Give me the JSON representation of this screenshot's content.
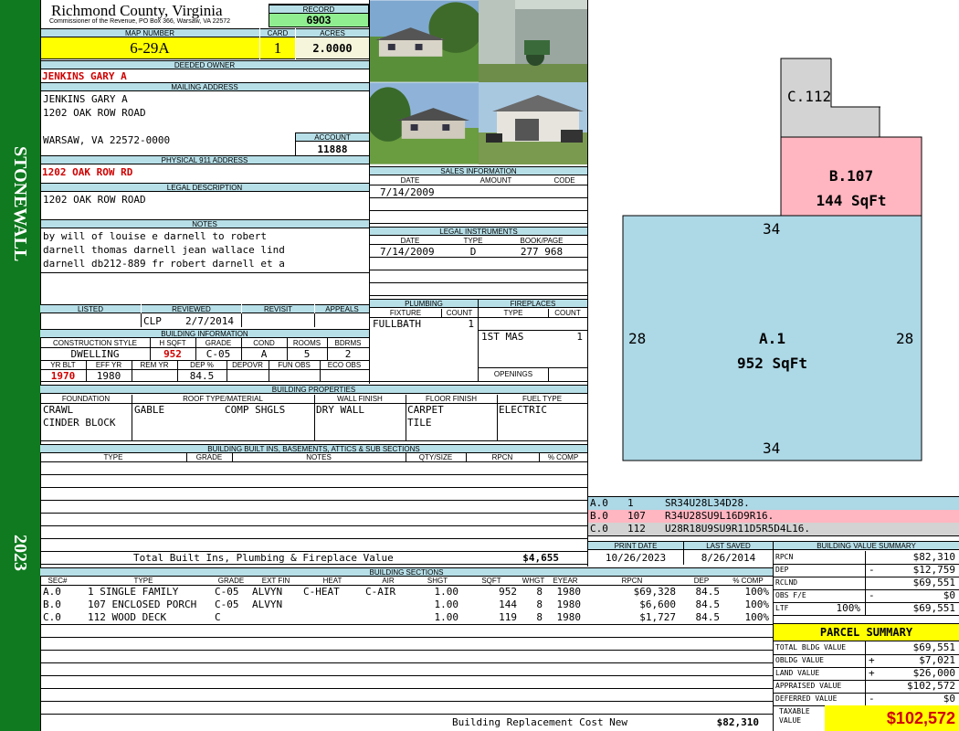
{
  "sidebar": {
    "district": "STONEWALL",
    "year": "2023"
  },
  "header": {
    "county": "Richmond County, Virginia",
    "address_line": "Commissioner of the Revenue, PO Box 366, Warsaw, VA 22572",
    "record_label": "RECORD",
    "record": "6903",
    "map_number_label": "MAP NUMBER",
    "map_number": "6-29A",
    "card_label": "CARD",
    "card": "1",
    "acres_label": "ACRES",
    "acres": "2.0000"
  },
  "owner": {
    "deeded_owner_label": "DEEDED OWNER",
    "deeded_owner": "JENKINS GARY A",
    "mailing_address_label": "MAILING ADDRESS",
    "mailing": [
      "JENKINS GARY A",
      "1202 OAK ROW ROAD",
      "",
      "WARSAW, VA 22572-0000"
    ],
    "account_label": "ACCOUNT",
    "account": "11888",
    "physical_label": "PHYSICAL 911 ADDRESS",
    "physical_address": "1202 OAK ROW RD",
    "legal_label": "LEGAL DESCRIPTION",
    "legal": "1202 OAK ROW ROAD",
    "notes_label": "NOTES",
    "notes": [
      "by will of louise e darnell to robert",
      "darnell thomas darnell jean wallace lind",
      "darnell db212-889 fr robert darnell et a"
    ]
  },
  "sales": {
    "label": "SALES INFORMATION",
    "cols": [
      "DATE",
      "AMOUNT",
      "CODE"
    ],
    "rows": [
      [
        "7/14/2009",
        "",
        ""
      ]
    ]
  },
  "legal_instruments": {
    "label": "LEGAL INSTRUMENTS",
    "cols": [
      "DATE",
      "TYPE",
      "BOOK/PAGE"
    ],
    "rows": [
      [
        "7/14/2009",
        "D",
        "277 968"
      ]
    ]
  },
  "review": {
    "cols": [
      "LISTED",
      "REVIEWED",
      "REVISIT",
      "APPEALS"
    ],
    "reviewed_by": "CLP",
    "reviewed_date": "2/7/2014"
  },
  "building_info": {
    "label": "BUILDING INFORMATION",
    "cols1": [
      "CONSTRUCTION STYLE",
      "H SQFT",
      "GRADE",
      "COND",
      "ROOMS",
      "BDRMS"
    ],
    "vals1": [
      "DWELLING",
      "952",
      "C-05",
      "A",
      "5",
      "2"
    ],
    "cols2": [
      "YR BLT",
      "EFF YR",
      "REM YR",
      "DEP %",
      "DEPOVR",
      "FUN OBS",
      "ECO OBS"
    ],
    "vals2": [
      "1970",
      "1980",
      "",
      "84.5",
      "",
      "",
      ""
    ]
  },
  "plumbing": {
    "label": "PLUMBING",
    "cols": [
      "FIXTURE",
      "COUNT"
    ],
    "rows": [
      [
        "FULLBATH",
        "1"
      ]
    ]
  },
  "fireplaces": {
    "label": "FIREPLACES",
    "cols": [
      "TYPE",
      "COUNT"
    ],
    "rows": [
      [
        "1ST MAS",
        "1"
      ]
    ],
    "openings_label": "OPENINGS"
  },
  "building_properties": {
    "label": "BUILDING PROPERTIES",
    "cols": [
      "FOUNDATION",
      "ROOF TYPE/MATERIAL",
      "WALL FINISH",
      "FLOOR FINISH",
      "FUEL TYPE"
    ],
    "foundation": [
      "CRAWL",
      "CINDER BLOCK"
    ],
    "roof_type": "GABLE",
    "roof_material": "COMP SHGLS",
    "wall": "DRY WALL",
    "floor": [
      "CARPET",
      "TILE"
    ],
    "fuel": "ELECTRIC"
  },
  "builtins": {
    "label": "BUILDING BUILT INS, BASEMENTS, ATTICS & SUB SECTIONS",
    "cols": [
      "TYPE",
      "GRADE",
      "NOTES",
      "QTY/SIZE",
      "RPCN",
      "% COMP"
    ],
    "total_label": "Total Built Ins, Plumbing & Fireplace Value",
    "total": "$4,655"
  },
  "sketch": {
    "sections": [
      {
        "label": "C.112",
        "area": ""
      },
      {
        "label": "B.107",
        "area": "144 SqFt"
      },
      {
        "label": "A.1",
        "area": "952 SqFt"
      }
    ],
    "dims": [
      "34",
      "28",
      "28",
      "34"
    ],
    "legend": [
      {
        "sec": "A.0",
        "num": "1",
        "code": "SR34U28L34D28.",
        "color": "#add8e6"
      },
      {
        "sec": "B.0",
        "num": "107",
        "code": "R34U28SU9L16D9R16.",
        "color": "#ffb6c1"
      },
      {
        "sec": "C.0",
        "num": "112",
        "code": "U28R18U9SU9R11D5R5D4L16.",
        "color": "#d3d3d3"
      }
    ]
  },
  "dates": {
    "print_label": "PRINT DATE",
    "print": "10/26/2023",
    "saved_label": "LAST SAVED",
    "saved": "8/26/2014"
  },
  "sections": {
    "label": "BUILDING SECTIONS",
    "cols": [
      "SEC#",
      "TYPE",
      "GRADE",
      "EXT FIN",
      "HEAT",
      "AIR",
      "SHGT",
      "SQFT",
      "WHGT",
      "EYEAR",
      "RPCN",
      "DEP",
      "% COMP"
    ],
    "rows": [
      [
        "A.0",
        "1 SINGLE FAMILY",
        "C-05",
        "ALVYN",
        "C-HEAT",
        "C-AIR",
        "1.00",
        "952",
        "8",
        "1980",
        "$69,328",
        "84.5",
        "100%"
      ],
      [
        "B.0",
        "107 ENCLOSED PORCH",
        "C-05",
        "ALVYN",
        "",
        "",
        "1.00",
        "144",
        "8",
        "1980",
        "$6,600",
        "84.5",
        "100%"
      ],
      [
        "C.0",
        "112 WOOD DECK",
        "C",
        "",
        "",
        "",
        "1.00",
        "119",
        "8",
        "1980",
        "$1,727",
        "84.5",
        "100%"
      ]
    ],
    "replacement_label": "Building Replacement Cost New",
    "replacement": "$82,310"
  },
  "value_summary": {
    "label": "BUILDING VALUE SUMMARY",
    "rows": [
      {
        "label": "RPCN",
        "sign": "",
        "pct": "",
        "value": "$82,310"
      },
      {
        "label": "DEP",
        "sign": "-",
        "pct": "",
        "value": "$12,759"
      },
      {
        "label": "RCLND",
        "sign": "",
        "pct": "",
        "value": "$69,551"
      },
      {
        "label": "OBS F/E",
        "sign": "-",
        "pct": "",
        "value": "$0"
      },
      {
        "label": "LTF",
        "sign": "",
        "pct": "100%",
        "value": "$69,551"
      }
    ]
  },
  "parcel": {
    "title": "PARCEL SUMMARY",
    "rows": [
      {
        "label": "TOTAL BLDG VALUE",
        "sign": "",
        "value": "$69,551"
      },
      {
        "label": "OBLDG VALUE",
        "sign": "+",
        "value": "$7,021"
      },
      {
        "label": "LAND VALUE",
        "sign": "+",
        "value": "$26,000"
      },
      {
        "label": "APPRAISED VALUE",
        "sign": "",
        "value": "$102,572"
      },
      {
        "label": "DEFERRED VALUE",
        "sign": "-",
        "value": "$0"
      }
    ],
    "taxable_label": "TAXABLE VALUE",
    "taxable": "$102,572"
  }
}
